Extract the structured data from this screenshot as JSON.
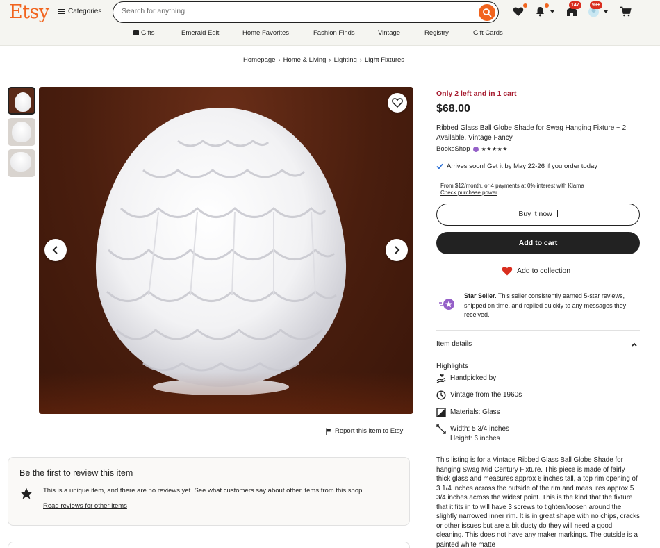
{
  "header": {
    "logo": "Etsy",
    "categories_label": "Categories",
    "search_placeholder": "Search for anything",
    "cart_badge": "147",
    "account_badge": "99+"
  },
  "nav": [
    "Gifts",
    "Emerald Edit",
    "Home Favorites",
    "Fashion Finds",
    "Vintage",
    "Registry",
    "Gift Cards"
  ],
  "breadcrumb": [
    "Homepage",
    "Home & Living",
    "Lighting",
    "Light Fixtures"
  ],
  "gallery": {
    "report_label": "Report this item to Etsy"
  },
  "reviews": {
    "title": "Be the first to review this item",
    "text": "This is a unique item, and there are no reviews yet. See what customers say about other items from this shop.",
    "link": "Read reviews for other items"
  },
  "product": {
    "stock": "Only 2 left and in 1 cart",
    "price": "$68.00",
    "title": "Ribbed Glass Ball Globe Shade for Swag Hanging Fixture ~ 2 Available, Vintage Fancy",
    "shop": "BooksShop",
    "stars": "★★★★★",
    "rating": 5,
    "arrives_prefix": "Arrives soon! Get it by ",
    "arrives_date": "May 22-26",
    "arrives_suffix": " if you order today",
    "klarna_line": "From $12/month, or 4 payments at 0% interest with Klarna",
    "klarna_link": "Check purchase power",
    "buy_label": "Buy it now",
    "cart_label": "Add to cart",
    "collection_label": "Add to collection",
    "star_seller_bold": "Star Seller.",
    "star_seller_text": " This seller consistently earned 5-star reviews, shipped on time, and replied quickly to any messages they received.",
    "details_label": "Item details",
    "highlights_label": "Highlights",
    "highlights": [
      {
        "icon": "hand-heart-icon",
        "text": "Handpicked by"
      },
      {
        "icon": "clock-icon",
        "text": "Vintage from the 1960s"
      },
      {
        "icon": "materials-icon",
        "text": "Materials: Glass"
      },
      {
        "icon": "dimensions-icon",
        "text": "Width: 5 3/4 inches",
        "text2": "Height: 6 inches"
      }
    ],
    "description": "This listing is for a Vintage Ribbed Glass Ball Globe Shade for hanging Swag Mid Century Fixture. This piece is made of fairly thick glass and measures approx 6 inches tall, a top rim opening of 3 1/4 inches across the outside of the rim and measures approx 5 3/4 inches across the widest point. This is the kind that the fixture that it fits in to will have 3 screws to tighten/loosen around the slightly narrowed inner rim. It is in great shape with no chips, cracks or other issues but are a bit dusty do they will need a good cleaning. This does not have any maker markings. The outside is a painted white matte"
  },
  "colors": {
    "brand_orange": "#f1641e",
    "stock_red": "#a61a2e",
    "dark_button": "#222222",
    "heart_red": "#d92e1f",
    "star_seller_purple": "#9560c8"
  }
}
